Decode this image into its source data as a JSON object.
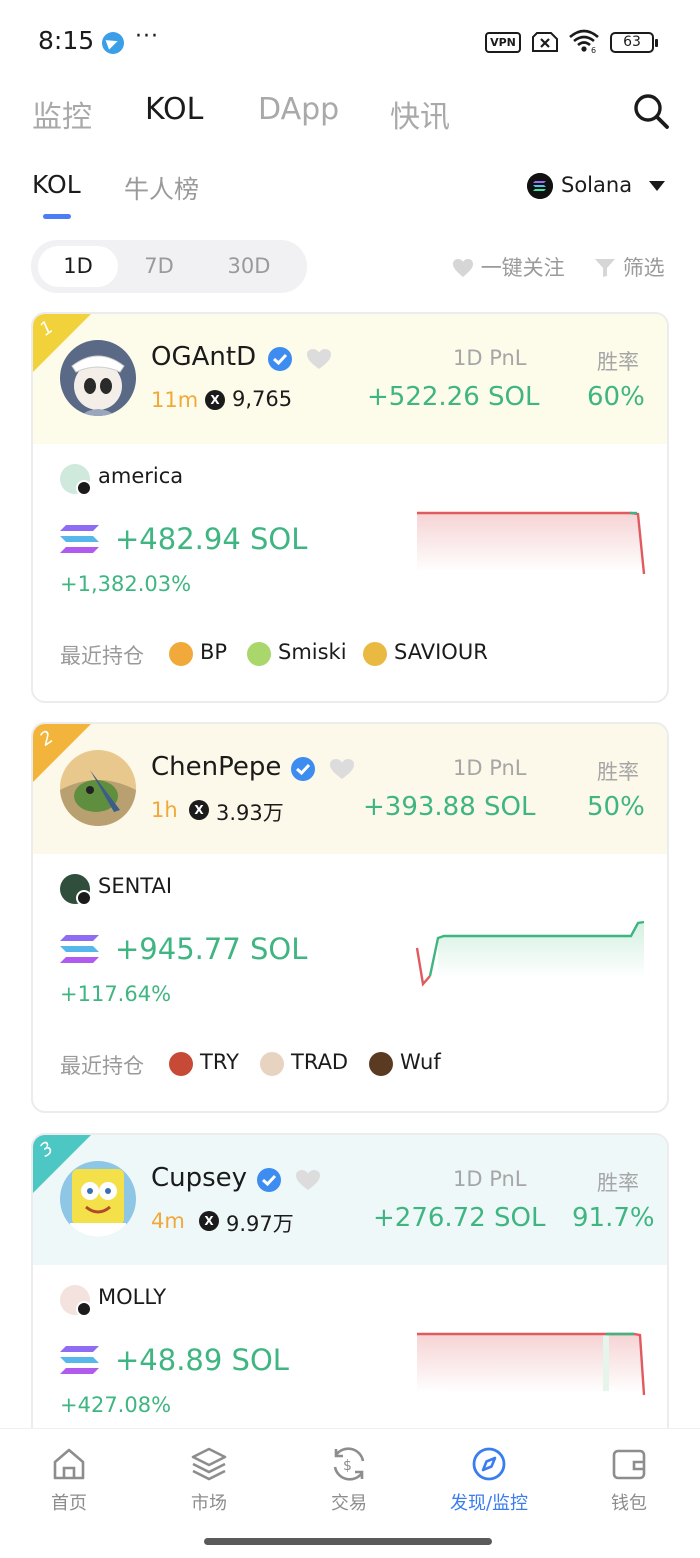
{
  "status_bar": {
    "time": "8:15",
    "dots": "···",
    "vpn": "VPN",
    "battery": "63"
  },
  "top_nav": {
    "tabs": [
      "监控",
      "KOL",
      "DApp",
      "快讯"
    ],
    "active": "KOL"
  },
  "sub_tabs": {
    "tabs": [
      "KOL",
      "牛人榜"
    ],
    "active": "KOL"
  },
  "chain": {
    "label": "Solana"
  },
  "periods": [
    "1D",
    "7D",
    "30D"
  ],
  "actions": {
    "follow_all": "一键关注",
    "filter": "筛选"
  },
  "cards": [
    {
      "rank": "1",
      "rank_color": "#f2d23a",
      "head_bg": "#fdfbea",
      "name": "OGAntD",
      "time": "11m",
      "followers": "9,765",
      "pnl_label": "1D PnL",
      "pnl": "+522.26 SOL",
      "winrate_label": "胜率",
      "winrate": "60%",
      "token": "america",
      "profit": "+482.94 SOL",
      "profit_pct": "+1,382.03%",
      "holdings_label": "最近持仓",
      "holdings": [
        "BP",
        "Smiski",
        "SAVIOUR"
      ],
      "trend": "down"
    },
    {
      "rank": "2",
      "rank_color": "#f2b43a",
      "head_bg": "#fcf8ea",
      "name": "ChenPepe",
      "time": "1h",
      "followers": "3.93万",
      "pnl_label": "1D PnL",
      "pnl": "+393.88 SOL",
      "winrate_label": "胜率",
      "winrate": "50%",
      "token": "SENTAI",
      "profit": "+945.77 SOL",
      "profit_pct": "+117.64%",
      "holdings_label": "最近持仓",
      "holdings": [
        "TRY",
        "TRAD",
        "Wuf"
      ],
      "trend": "up"
    },
    {
      "rank": "3",
      "rank_color": "#4cc7c3",
      "head_bg": "#eef8f9",
      "name": "Cupsey",
      "time": "4m",
      "followers": "9.97万",
      "pnl_label": "1D PnL",
      "pnl": "+276.72 SOL",
      "winrate_label": "胜率",
      "winrate": "91.7%",
      "token": "MOLLY",
      "profit": "+48.89 SOL",
      "profit_pct": "+427.08%",
      "trend": "down"
    }
  ],
  "bottom_nav": [
    {
      "label": "首页",
      "icon": "home-icon"
    },
    {
      "label": "市场",
      "icon": "layers-icon"
    },
    {
      "label": "交易",
      "icon": "exchange-icon"
    },
    {
      "label": "发现/监控",
      "icon": "compass-icon",
      "active": true
    },
    {
      "label": "钱包",
      "icon": "wallet-icon"
    }
  ],
  "colors": {
    "accent": "#4d7cf5",
    "profit": "#3fb581",
    "loss": "#e05a5f",
    "time": "#f0a93a"
  }
}
